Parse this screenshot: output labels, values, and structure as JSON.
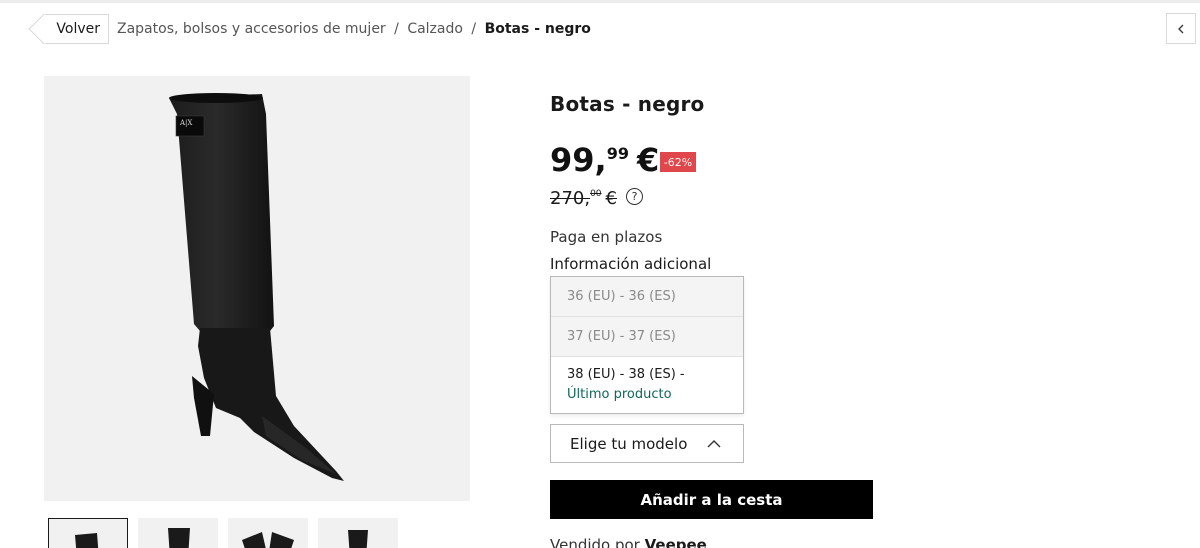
{
  "breadcrumb": {
    "back_label": "Volver",
    "items": [
      "Zapatos, bolsos y accesorios de mujer",
      "Calzado"
    ],
    "separator": "/",
    "current": "Botas - negro"
  },
  "product": {
    "title": "Botas - negro",
    "price": {
      "integer": "99,",
      "decimals": "99",
      "currency": "€"
    },
    "discount_badge": "-62%",
    "old_price": {
      "integer": "270,",
      "decimals": "00",
      "currency": "€"
    },
    "installments_label": "Paga en plazos",
    "additional_info_label": "Información adicional",
    "logo_text": "A|X"
  },
  "size_options": [
    {
      "label": "36 (EU) - 36 (ES)",
      "available": false
    },
    {
      "label": "37 (EU) - 37 (ES)",
      "available": false
    },
    {
      "label": "38 (EU) - 38 (ES) - ",
      "note": "Último producto",
      "available": true
    }
  ],
  "model_select": {
    "placeholder": "Elige tu modelo"
  },
  "cart": {
    "add_label": "Añadir a la cesta"
  },
  "seller": {
    "prefix": "Vendido por",
    "name": "Veepee"
  },
  "colors": {
    "accent_badge": "#e0474c",
    "last_unit": "#12665a",
    "button": "#000000"
  },
  "icons": [
    "help-icon",
    "chevron-up-icon",
    "chevron-left-icon"
  ]
}
